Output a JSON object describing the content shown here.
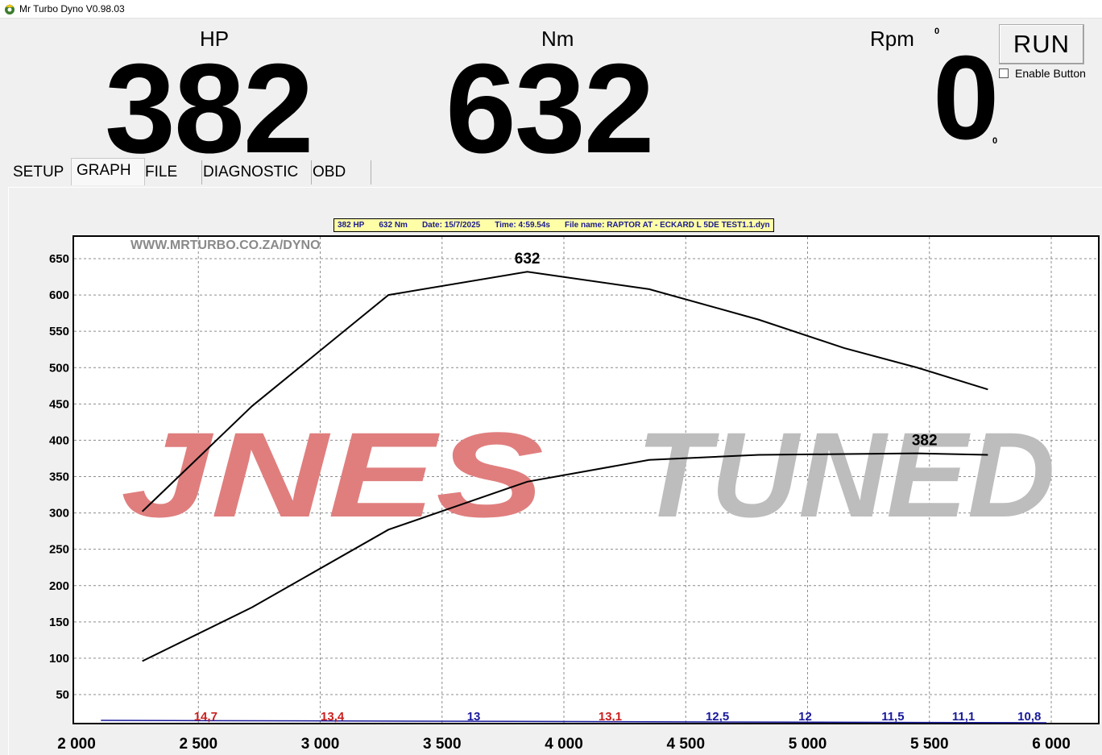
{
  "window": {
    "title": "Mr Turbo Dyno V0.98.03",
    "icon": "dyno-app-icon"
  },
  "readouts": {
    "hp": {
      "label": "HP",
      "value": "382"
    },
    "nm": {
      "label": "Nm",
      "value": "632"
    },
    "rpm": {
      "label": "Rpm",
      "value": "0",
      "top_small": "0",
      "bottom_small": "0"
    }
  },
  "controls": {
    "run_label": "RUN",
    "enable_label": "Enable Button",
    "enable_checked": false
  },
  "tabs": [
    {
      "label": "SETUP",
      "active": false
    },
    {
      "label": "GRAPH",
      "active": true
    },
    {
      "label": "FILE",
      "active": false
    },
    {
      "label": "DIAGNOSTIC",
      "active": false
    },
    {
      "label": "OBD",
      "active": false
    }
  ],
  "info_bar": {
    "hp": "382 HP",
    "nm": "632 Nm",
    "date": "Date: 15/7/2025",
    "time": "Time: 4:59.54s",
    "file": "File name: RAPTOR AT - ECKARD L 5DE TEST1.1.dyn"
  },
  "watermark": {
    "site": "WWW.MRTURBO.CO.ZA/DYNO",
    "brand_left": "JNES",
    "brand_right": "TUNED",
    "brand_left_color": "#e07e7e",
    "brand_right_color": "#bdbdbd"
  },
  "chart_data": {
    "type": "line",
    "xlim": [
      2000,
      6000
    ],
    "ylim": [
      0,
      680
    ],
    "x_ticks": [
      2000,
      2500,
      3000,
      3500,
      4000,
      4500,
      5000,
      5500,
      6000
    ],
    "x_tick_labels": [
      "2 000",
      "2 500",
      "3 000",
      "3 500",
      "4 000",
      "4 500",
      "5 000",
      "5 500",
      "6 000"
    ],
    "y_ticks": [
      50,
      100,
      150,
      200,
      250,
      300,
      350,
      400,
      450,
      500,
      550,
      600,
      650
    ],
    "y_tick_labels": [
      "50",
      "100",
      "150",
      "200",
      "250",
      "300",
      "350",
      "400",
      "450",
      "500",
      "550",
      "600",
      "650"
    ],
    "grid": true,
    "series": [
      {
        "color": "#000000",
        "x": [
          2270,
          2720,
          3280,
          3850,
          4350,
          4800,
          5150,
          5450,
          5740
        ],
        "y": [
          302,
          447,
          600,
          632,
          608,
          566,
          527,
          500,
          470
        ]
      },
      {
        "color": "#000000",
        "x": [
          2270,
          2720,
          3280,
          3850,
          4350,
          4800,
          5150,
          5450,
          5740
        ],
        "y": [
          96,
          170,
          277,
          343,
          373,
          380,
          381,
          382,
          380
        ]
      }
    ],
    "peak_labels": [
      {
        "text": "632",
        "x": 3850,
        "y": 632
      },
      {
        "text": "382",
        "x": 5480,
        "y": 382
      }
    ],
    "afr_labels": [
      {
        "text": "14,7",
        "x": 2530,
        "color": "#cc1f1f"
      },
      {
        "text": "13,4",
        "x": 3050,
        "color": "#cc1f1f"
      },
      {
        "text": "13",
        "x": 3630,
        "color": "#1a1a9c"
      },
      {
        "text": "13,1",
        "x": 4190,
        "color": "#cc1f1f"
      },
      {
        "text": "12,5",
        "x": 4630,
        "color": "#1a1a9c"
      },
      {
        "text": "12",
        "x": 4990,
        "color": "#1a1a9c"
      },
      {
        "text": "11,5",
        "x": 5350,
        "color": "#1a1a9c"
      },
      {
        "text": "11,1",
        "x": 5640,
        "color": "#1a1a9c"
      },
      {
        "text": "10,8",
        "x": 5910,
        "color": "#1a1a9c"
      }
    ],
    "afr_line": {
      "x": [
        2100,
        5980
      ],
      "y_value": 13
    }
  }
}
